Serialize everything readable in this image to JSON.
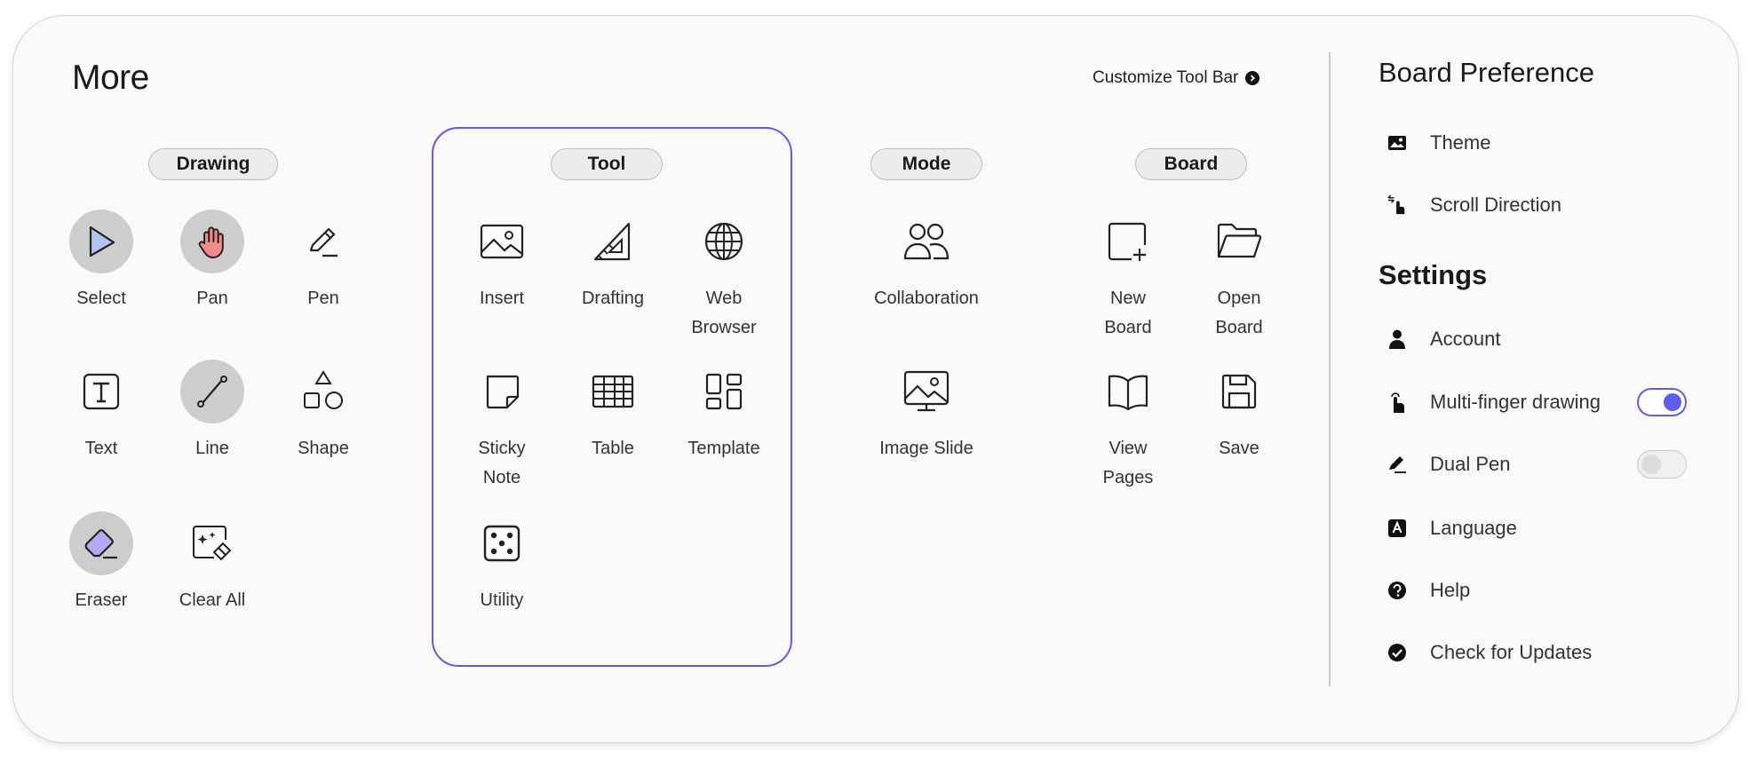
{
  "title": "More",
  "customize": {
    "label": "Customize Tool Bar",
    "icon": "chevron-right-circle-icon"
  },
  "groups": {
    "drawing": "Drawing",
    "tool": "Tool",
    "mode": "Mode",
    "board": "Board"
  },
  "drawing": [
    {
      "label": "Select",
      "icon": "select-arrow-icon",
      "selected": true
    },
    {
      "label": "Pan",
      "icon": "hand-icon",
      "selected": true
    },
    {
      "label": "Pen",
      "icon": "pen-icon",
      "selected": false
    },
    {
      "label": "Text",
      "icon": "text-icon",
      "selected": false
    },
    {
      "label": "Line",
      "icon": "line-icon",
      "selected": true
    },
    {
      "label": "Shape",
      "icon": "shape-icon",
      "selected": false
    },
    {
      "label": "Eraser",
      "icon": "eraser-icon",
      "selected": true
    },
    {
      "label": "Clear All",
      "icon": "clear-all-icon",
      "selected": false
    }
  ],
  "tools": [
    {
      "label": "Insert",
      "icon": "image-icon"
    },
    {
      "label": "Drafting",
      "icon": "set-square-icon"
    },
    {
      "label": "Web\nBrowser",
      "icon": "globe-icon"
    },
    {
      "label": "Sticky\nNote",
      "icon": "sticky-note-icon"
    },
    {
      "label": "Table",
      "icon": "table-icon"
    },
    {
      "label": "Template",
      "icon": "template-icon"
    },
    {
      "label": "Utility",
      "icon": "dice-icon"
    }
  ],
  "modes": [
    {
      "label": "Collaboration",
      "icon": "people-icon"
    },
    {
      "label": "Image Slide",
      "icon": "image-slide-icon"
    }
  ],
  "board": [
    {
      "label": "New\nBoard",
      "icon": "new-board-icon"
    },
    {
      "label": "Open\nBoard",
      "icon": "folder-open-icon"
    },
    {
      "label": "View\nPages",
      "icon": "book-icon"
    },
    {
      "label": "Save",
      "icon": "save-icon"
    }
  ],
  "board_preference": {
    "title": "Board Preference",
    "items": [
      {
        "label": "Theme",
        "icon": "theme-image-icon"
      },
      {
        "label": "Scroll Direction",
        "icon": "scroll-direction-icon"
      }
    ]
  },
  "settings": {
    "title": "Settings",
    "items": [
      {
        "label": "Account",
        "icon": "person-icon"
      },
      {
        "label": "Multi-finger drawing",
        "icon": "touch-icon",
        "toggle": "on"
      },
      {
        "label": "Dual Pen",
        "icon": "pen-slash-icon",
        "toggle": "off"
      },
      {
        "label": "Language",
        "icon": "language-icon"
      },
      {
        "label": "Help",
        "icon": "help-icon"
      },
      {
        "label": "Check for Updates",
        "icon": "check-circle-icon"
      }
    ]
  },
  "colors": {
    "accent": "#5f5cf0",
    "selected_bg": "#cdcdcd",
    "pan_red": "#f28a8a",
    "select_blue": "#b4c4f0",
    "eraser_purple": "#b6a8f4"
  }
}
